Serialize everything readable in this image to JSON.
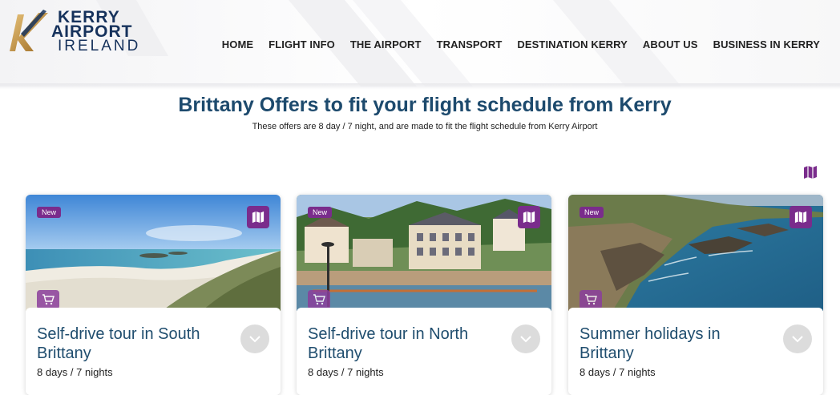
{
  "brand": {
    "line1": "KERRY",
    "line2": "AIRPORT",
    "line3": "IRELAND",
    "colors": {
      "navy": "#16325c",
      "gold": "#c9963a",
      "purple": "#7a2c8c"
    }
  },
  "nav": {
    "items": [
      {
        "label": "HOME"
      },
      {
        "label": "FLIGHT INFO"
      },
      {
        "label": "THE AIRPORT"
      },
      {
        "label": "TRANSPORT"
      },
      {
        "label": "DESTINATION KERRY"
      },
      {
        "label": "ABOUT US"
      },
      {
        "label": "BUSINESS IN KERRY"
      }
    ]
  },
  "page": {
    "title": "Brittany Offers to fit your flight schedule from Kerry",
    "subtitle": "These offers are 8 day / 7 night, and are made to fit the flight schedule from Kerry Airport",
    "map_toggle_icon": "map-icon"
  },
  "offers": [
    {
      "badge": "New",
      "title": "Self-drive tour in South Brittany",
      "meta": "8 days / 7 nights",
      "image": "beach-scene",
      "icons": [
        "map-icon",
        "cart-icon",
        "chevron-down-icon"
      ]
    },
    {
      "badge": "New",
      "title": "Self-drive tour in North Brittany",
      "meta": "8 days / 7 nights",
      "image": "harbour-town-scene",
      "icons": [
        "map-icon",
        "cart-icon",
        "chevron-down-icon"
      ]
    },
    {
      "badge": "New",
      "title": "Summer holidays in Brittany",
      "meta": "8 days / 7 nights",
      "image": "coastal-cliffs-scene",
      "icons": [
        "map-icon",
        "cart-icon",
        "chevron-down-icon"
      ]
    }
  ]
}
